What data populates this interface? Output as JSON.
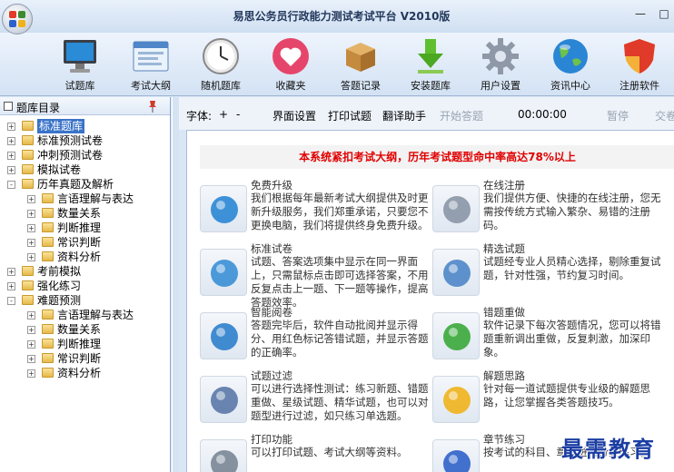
{
  "window": {
    "title": "易思公务员行政能力测试考试平台 V2010版"
  },
  "toolbar": {
    "items": [
      {
        "label": "试题库",
        "icon": "monitor-icon"
      },
      {
        "label": "考试大纲",
        "icon": "outline-window-icon"
      },
      {
        "label": "随机题库",
        "icon": "clock-icon"
      },
      {
        "label": "收藏夹",
        "icon": "heart-icon"
      },
      {
        "label": "答题记录",
        "icon": "box-icon"
      },
      {
        "label": "安装题库",
        "icon": "download-arrow-icon"
      },
      {
        "label": "用户设置",
        "icon": "gear-icon"
      },
      {
        "label": "资讯中心",
        "icon": "globe-icon"
      },
      {
        "label": "注册软件",
        "icon": "shield-icon"
      }
    ]
  },
  "sidebar": {
    "header": "题库目录",
    "nodes": [
      {
        "label": "标准题库",
        "level": 0,
        "expander": "+",
        "selected": true
      },
      {
        "label": "标准预测试卷",
        "level": 0,
        "expander": "+"
      },
      {
        "label": "冲刺预测试卷",
        "level": 0,
        "expander": "+"
      },
      {
        "label": "模拟试卷",
        "level": 0,
        "expander": "+"
      },
      {
        "label": "历年真题及解析",
        "level": 0,
        "expander": "-"
      },
      {
        "label": "言语理解与表达",
        "level": 1,
        "expander": "+"
      },
      {
        "label": "数量关系",
        "level": 1,
        "expander": "+"
      },
      {
        "label": "判断推理",
        "level": 1,
        "expander": "+"
      },
      {
        "label": "常识判断",
        "level": 1,
        "expander": "+"
      },
      {
        "label": "资料分析",
        "level": 1,
        "expander": "+"
      },
      {
        "label": "考前模拟",
        "level": 0,
        "expander": "+"
      },
      {
        "label": "强化练习",
        "level": 0,
        "expander": "+"
      },
      {
        "label": "难题预测",
        "level": 0,
        "expander": "-"
      },
      {
        "label": "言语理解与表达",
        "level": 1,
        "expander": "+"
      },
      {
        "label": "数量关系",
        "level": 1,
        "expander": "+"
      },
      {
        "label": "判断推理",
        "level": 1,
        "expander": "+"
      },
      {
        "label": "常识判断",
        "level": 1,
        "expander": "+"
      },
      {
        "label": "资料分析",
        "level": 1,
        "expander": "+"
      }
    ]
  },
  "quizbar": {
    "font_label": "字体:",
    "font_plus": "+",
    "font_minus": "-",
    "ui_settings": "界面设置",
    "print_quiz": "打印试题",
    "translate": "翻译助手",
    "start": "开始答题",
    "timer": "00:00:00",
    "pause": "暂停",
    "submit": "交卷"
  },
  "content": {
    "banner": "本系统紧扣考试大纲，历年考试题型命中率高达78%以上",
    "features": [
      {
        "title": "免费升级",
        "desc": "我们根据每年最新考试大纲提供及时更新升级服务，我们郑重承诺，只要您不更换电脑，我们将提供终身免费升级。",
        "icon": "globe-computer-icon"
      },
      {
        "title": "在线注册",
        "desc": "我们提供方便、快捷的在线注册，您无需按传统方式输入繁杂、易错的注册码。",
        "icon": "database-lock-icon"
      },
      {
        "title": "标准试卷",
        "desc": "试题、答案选项集中显示在同一界面上，只需鼠标点击即可选择答案，不用反复点击上一题、下一题等操作，提高答题效率。",
        "icon": "paper-chat-icon"
      },
      {
        "title": "精选试题",
        "desc": "试题经专业人员精心选择，剔除重复试题，针对性强，节约复习时间。",
        "icon": "window-arrow-icon"
      },
      {
        "title": "智能阅卷",
        "desc": "答题完毕后，软件自动批阅并显示得分、用红色标记答错试题，并显示答题的正确率。",
        "icon": "gear-blue-icon"
      },
      {
        "title": "错题重做",
        "desc": "软件记录下每次答题情况，您可以将错题重新调出重做，反复刺激，加深印象。",
        "icon": "user-add-icon"
      },
      {
        "title": "试题过滤",
        "desc": "可以进行选择性测试：练习新题、错题重做、星级试题、精华试题，也可以对题型进行过滤，如只练习单选题。",
        "icon": "magnifier-icon"
      },
      {
        "title": "解题思路",
        "desc": "针对每一道试题提供专业级的解题思路，让您掌握各类答题技巧。",
        "icon": "chat-bubbles-icon"
      },
      {
        "title": "打印功能",
        "desc": "可以打印试题、考试大纲等资料。",
        "icon": "printer-icon"
      },
      {
        "title": "章节练习",
        "desc": "按考试的科目、章节进行分类练习，",
        "icon": "pen-paper-icon"
      }
    ]
  },
  "watermark": "最需教育"
}
